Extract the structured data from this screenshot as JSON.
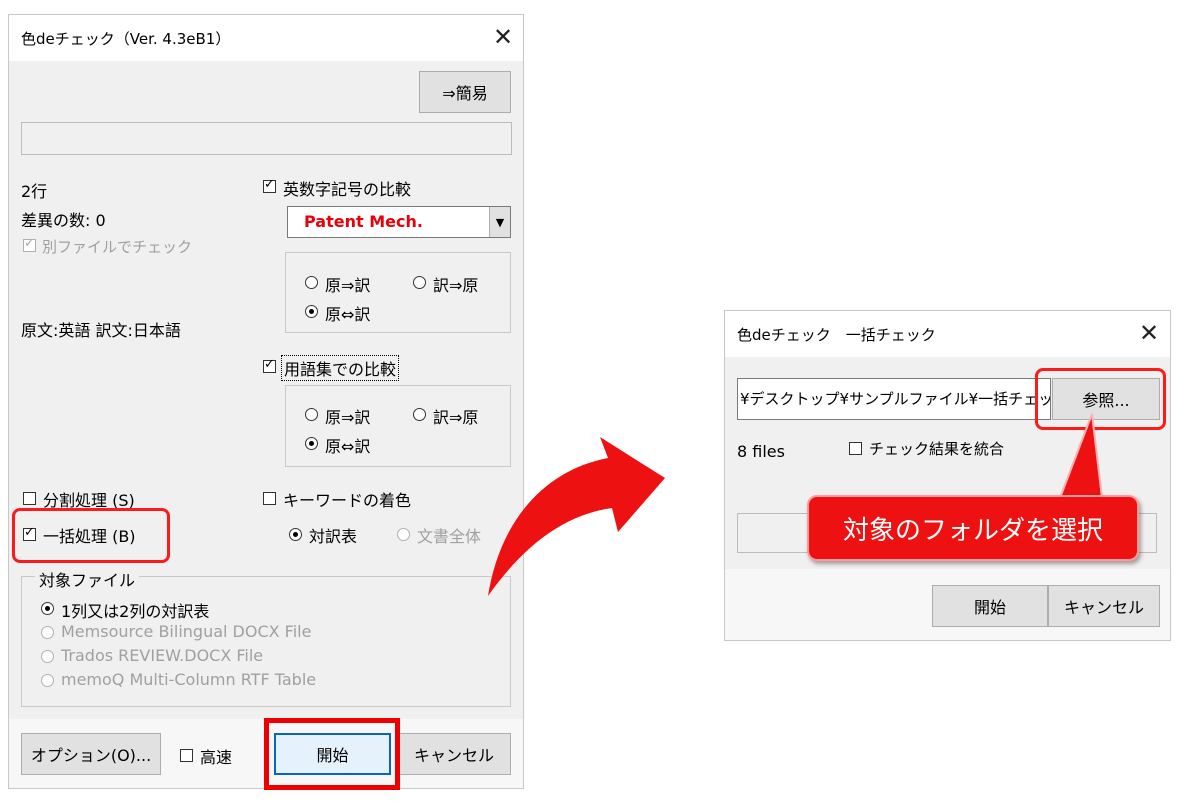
{
  "main_window": {
    "title": "色deチェック（Ver. 4.3eB1）",
    "simple_button": "⇒簡易",
    "line_count": "2行",
    "diff_count": "差異の数: 0",
    "separate_file_check": {
      "label": "別ファイルでチェック",
      "checked": true,
      "disabled": true
    },
    "lang_pair": "原文:英語 訳文:日本語",
    "alnum_compare": {
      "label": "英数字記号の比較",
      "checked": true
    },
    "dictionary_select": {
      "value": "Patent Mech.",
      "color": "#e8000b"
    },
    "alnum_direction": {
      "src_to_tgt": "原⇒訳",
      "tgt_to_src": "訳⇒原",
      "both": "原⇔訳",
      "selected": "both"
    },
    "glossary_compare": {
      "label": "用語集での比較",
      "checked": true
    },
    "glossary_direction": {
      "src_to_tgt": "原⇒訳",
      "tgt_to_src": "訳⇒原",
      "both": "原⇔訳",
      "selected": "both"
    },
    "split_process": {
      "label": "分割処理 (S)",
      "checked": false
    },
    "batch_process": {
      "label": "一括処理 (B)",
      "checked": true
    },
    "keyword_color": {
      "label": "キーワードの着色",
      "checked": false
    },
    "keyword_scope": {
      "table": "対訳表",
      "whole": "文書全体",
      "selected": "table"
    },
    "target_file": {
      "legend": "対象ファイル",
      "options": [
        "1列又は2列の対訳表",
        "Memsource Bilingual DOCX File",
        "Trados REVIEW.DOCX File",
        "memoQ Multi-Column RTF Table"
      ],
      "selected": 0
    },
    "options_button": "オプション(O)...",
    "fast": {
      "label": "高速",
      "checked": false
    },
    "start_button": "開始",
    "cancel_button": "キャンセル"
  },
  "batch_window": {
    "title": "色deチェック　一括チェック",
    "folder_path": "¥デスクトップ¥サンプルファイル¥一括チェック",
    "browse_button": "参照...",
    "file_count": "8 files",
    "merge_results": {
      "label": "チェック結果を統合",
      "checked": false
    },
    "start_button": "開始",
    "cancel_button": "キャンセル"
  },
  "callout": {
    "text": "対象のフォルダを選択",
    "color": "#ee1111"
  },
  "highlight_color": "#ff1a1a"
}
